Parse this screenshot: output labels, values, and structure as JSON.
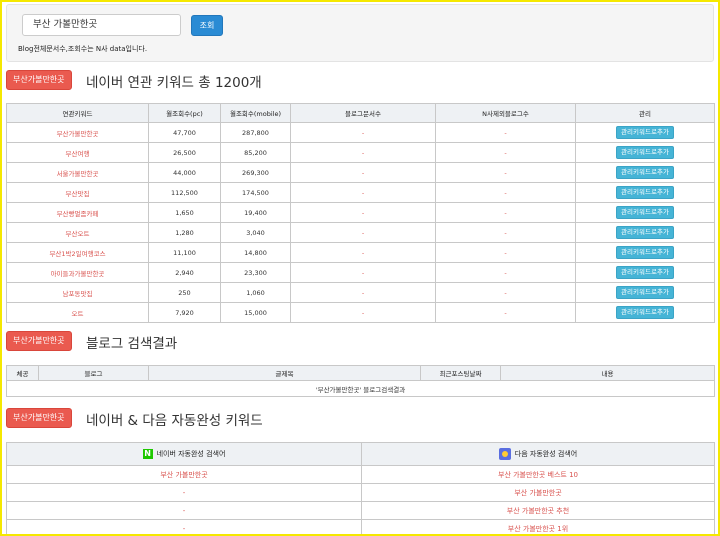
{
  "search": {
    "value": "부산 가볼만한곳",
    "button": "조회",
    "note": "Blog전체문서수,조회수는 N사 data입니다."
  },
  "tag_label": "부산가볼만한곳",
  "section1_title": "네이버 연관 키워드 총 1200개",
  "section2_title": "블로그 검색결과",
  "section3_title": "네이버 & 다음 자동완성 키워드",
  "kw_headers": [
    "연관키워드",
    "월조회수(pc)",
    "월조회수(mobile)",
    "블로그문서수",
    "N사제외블로그수",
    "관리"
  ],
  "kw_rows": [
    [
      "부산가볼만한곳",
      "47,700",
      "287,800",
      "-",
      "-"
    ],
    [
      "부산여행",
      "26,500",
      "85,200",
      "-",
      "-"
    ],
    [
      "서울가볼만한곳",
      "44,000",
      "269,300",
      "-",
      "-"
    ],
    [
      "부산맛집",
      "112,500",
      "174,500",
      "-",
      "-"
    ],
    [
      "부산빵멀좀카페",
      "1,650",
      "19,400",
      "-",
      "-"
    ],
    [
      "부산오트",
      "1,280",
      "3,040",
      "-",
      "-"
    ],
    [
      "부산1박2일여행코스",
      "11,100",
      "14,800",
      "-",
      "-"
    ],
    [
      "아이들과가볼만한곳",
      "2,940",
      "23,300",
      "-",
      "-"
    ],
    [
      "남포동맛집",
      "250",
      "1,060",
      "-",
      "-"
    ],
    [
      "오트",
      "7,920",
      "15,000",
      "-",
      "-"
    ]
  ],
  "add_button": "관리키워드로추가",
  "blog_headers": [
    "체공",
    "블로그",
    "글제목",
    "최근포스팅날짜",
    "내용"
  ],
  "blog_result": "'부산가볼만한곳' 블로그검색결과",
  "ac_headers": {
    "naver": "네이버 자동완성 검색어",
    "daum": "다음 자동완성 검색어",
    "naver_logo": "N"
  },
  "ac_rows": [
    [
      "부산 가볼만한곳",
      "부산 가볼만한곳 베스트 10"
    ],
    [
      "-",
      "부산 가볼만한곳"
    ],
    [
      "-",
      "부산 가볼만한곳 추천"
    ],
    [
      "-",
      "부산 가볼만한곳 1위"
    ]
  ],
  "colors": {
    "tag": "#ea5a4f",
    "button": "#2a8bd4",
    "add_button": "#46b4d6",
    "keyword": "#d9534f"
  }
}
